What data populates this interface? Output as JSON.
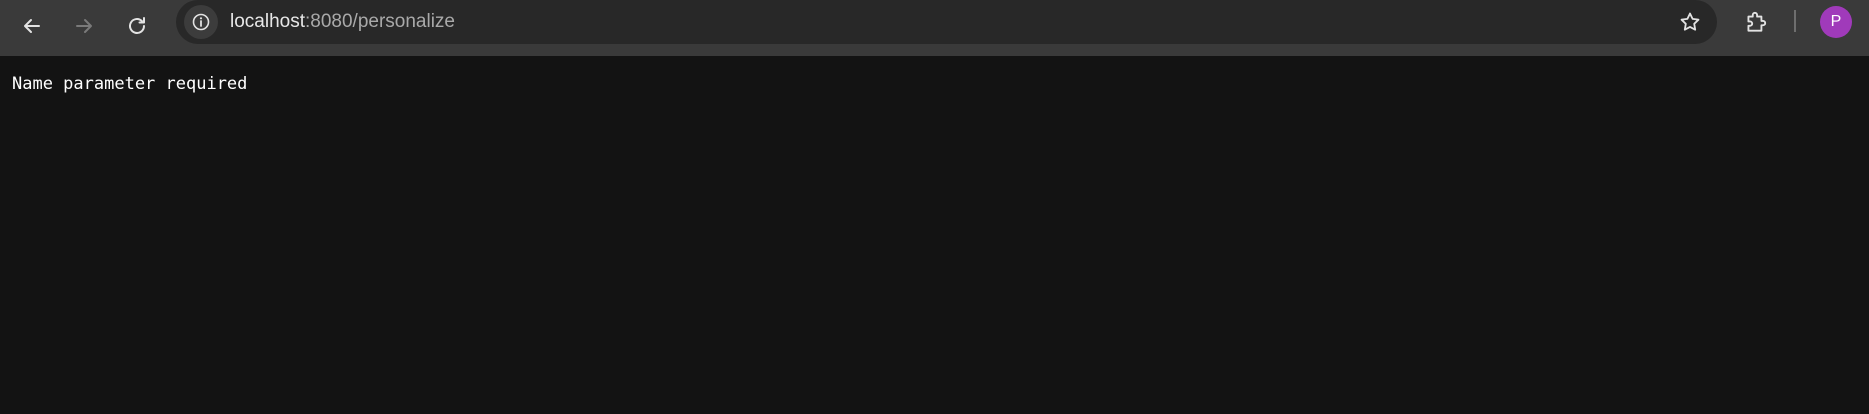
{
  "browser": {
    "url_host": "localhost",
    "url_path": ":8080/personalize",
    "profile_initial": "P",
    "icons": {
      "back": "arrow-left-icon",
      "forward": "arrow-right-icon",
      "reload": "reload-icon",
      "site_info": "info-icon",
      "bookmark": "star-icon",
      "extensions": "puzzle-icon"
    },
    "colors": {
      "toolbar": "#3a3a3a",
      "omnibox": "#282828",
      "avatar": "#a03aba",
      "page_background": "#131313"
    }
  },
  "page": {
    "message": "Name parameter required"
  }
}
